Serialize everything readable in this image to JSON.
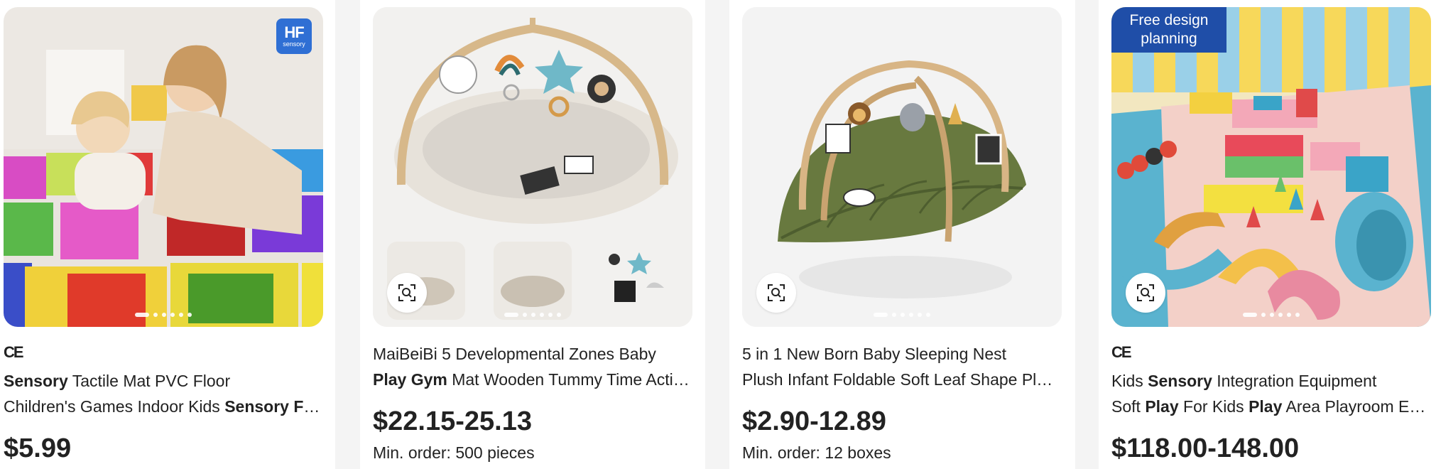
{
  "products": [
    {
      "badge": "HF",
      "badge_sub": "sensory",
      "cert": "CE",
      "title_line1": [
        {
          "t": "Sensory",
          "b": true
        },
        {
          "t": " Tactile Mat PVC Floor",
          "b": false
        }
      ],
      "title_line2": [
        {
          "t": "Children's Games Indoor Kids ",
          "b": false
        },
        {
          "t": "Sensory Floor Tiles",
          "b": true
        }
      ],
      "price": "$5.99",
      "icon": "image-search-icon"
    },
    {
      "title_line1": [
        {
          "t": "MaiBeiBi 5 Developmental Zones Baby",
          "b": false
        }
      ],
      "title_line2": [
        {
          "t": "Play Gym",
          "b": true
        },
        {
          "t": " Mat Wooden Tummy Time Activity Mat",
          "b": false
        }
      ],
      "price": "$22.15-25.13",
      "moq": "Min. order: 500 pieces",
      "icon": "image-search-icon"
    },
    {
      "title_line1": [
        {
          "t": "5 in 1 New Born Baby Sleeping Nest",
          "b": false
        }
      ],
      "title_line2": [
        {
          "t": "Plush Infant Foldable Soft Leaf Shape Play Gym",
          "b": false
        }
      ],
      "price": "$2.90-12.89",
      "moq": "Min. order: 12 boxes",
      "icon": "image-search-icon"
    },
    {
      "badge": "Free design planning",
      "cert": "CE",
      "title_line1": [
        {
          "t": "Kids ",
          "b": false
        },
        {
          "t": "Sensory",
          "b": true
        },
        {
          "t": " Integration Equipment",
          "b": false
        }
      ],
      "title_line2": [
        {
          "t": "Soft ",
          "b": false
        },
        {
          "t": "Play",
          "b": true
        },
        {
          "t": " For Kids ",
          "b": false
        },
        {
          "t": "Play",
          "b": true
        },
        {
          "t": " Area Playroom Equipment",
          "b": false
        }
      ],
      "price": "$118.00-148.00",
      "icon": "image-search-icon"
    }
  ],
  "colors": {
    "badge_blue": "#2f6fd4",
    "free_badge_blue": "#1f4ea8",
    "text": "#222222"
  }
}
